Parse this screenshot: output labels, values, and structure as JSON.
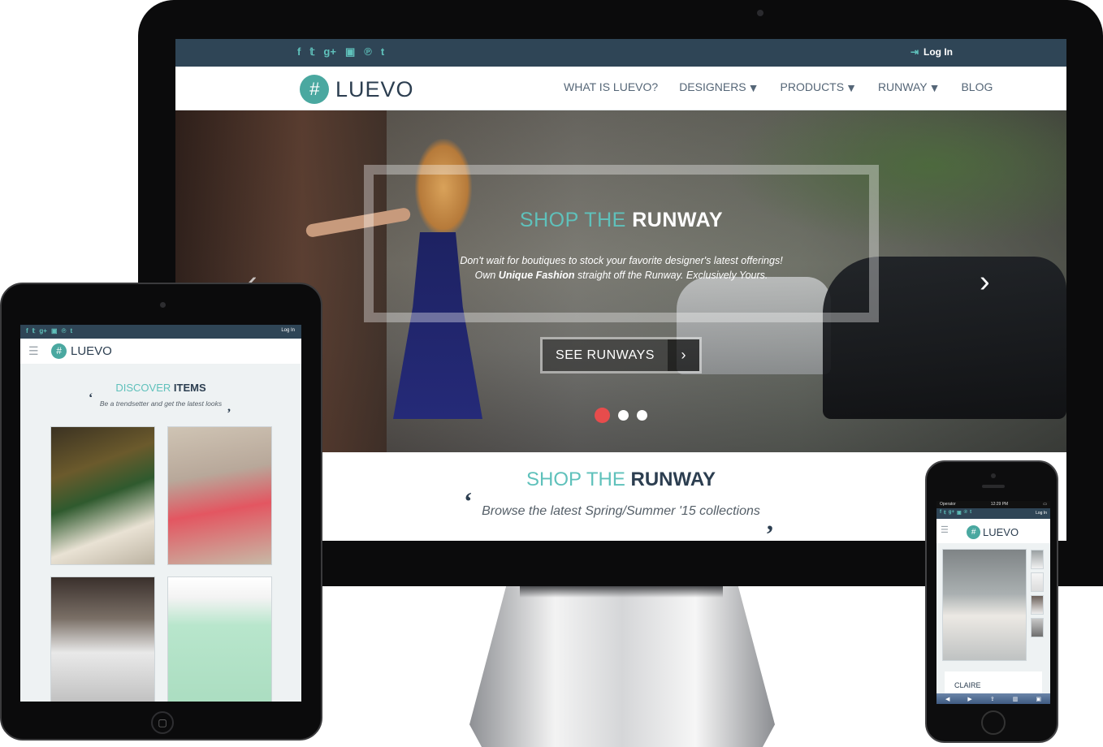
{
  "desktop": {
    "social_icons": [
      {
        "name": "facebook-icon",
        "glyph": "f"
      },
      {
        "name": "twitter-icon",
        "glyph": "t"
      },
      {
        "name": "googleplus-icon",
        "glyph": "g+"
      },
      {
        "name": "instagram-icon",
        "glyph": "▣"
      },
      {
        "name": "pinterest-icon",
        "glyph": "℗"
      },
      {
        "name": "tumblr-icon",
        "glyph": "t"
      }
    ],
    "login_label": "Log In",
    "logo_text": "LUEVO",
    "nav": {
      "what_is": "WHAT IS LUEVO?",
      "designers": "DESIGNERS",
      "products": "PRODUCTS",
      "runway": "RUNWAY",
      "blog": "BLOG"
    },
    "hero": {
      "title_light": "SHOP THE ",
      "title_bold": "RUNWAY",
      "line1": "Don't wait for boutiques to stock your favorite designer's latest offerings!",
      "line2_prefix": "Own ",
      "line2_bold": "Unique Fashion",
      "line2_suffix": " straight off the Runway. Exclusively Yours.",
      "cta_label": "SEE RUNWAYS",
      "slide_count": 3,
      "active_slide": 1
    },
    "section": {
      "title_light": "SHOP THE ",
      "title_bold": "RUNWAY",
      "subtitle": "Browse the latest Spring/Summer '15 collections"
    }
  },
  "tablet": {
    "login_label": "Log In",
    "logo_text": "LUEVO",
    "title_light": "DISCOVER ",
    "title_bold": "ITEMS",
    "subtitle": "Be a trendsetter and get the latest looks"
  },
  "phone": {
    "carrier": "Operator",
    "time": "12:29 PM",
    "login_label": "Log In",
    "logo_text": "LUEVO",
    "product_name": "CLAIRE"
  },
  "colors": {
    "teal": "#5fc1bb",
    "navy": "#2f4556",
    "dot_active": "#e74c4c"
  }
}
